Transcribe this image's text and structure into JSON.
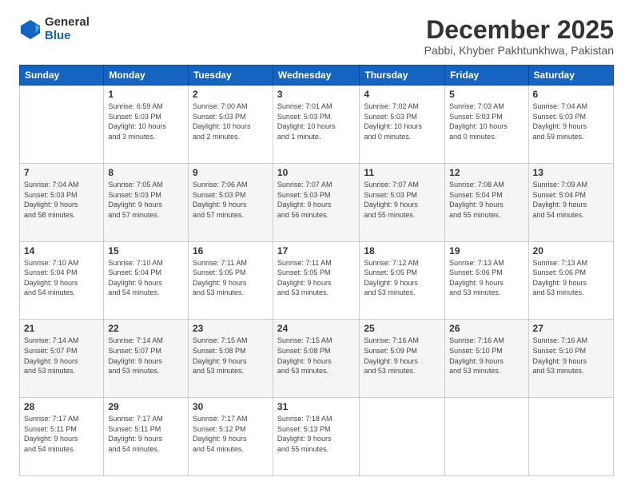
{
  "logo": {
    "general": "General",
    "blue": "Blue"
  },
  "title": "December 2025",
  "location": "Pabbi, Khyber Pakhtunkhwa, Pakistan",
  "weekdays": [
    "Sunday",
    "Monday",
    "Tuesday",
    "Wednesday",
    "Thursday",
    "Friday",
    "Saturday"
  ],
  "weeks": [
    [
      {
        "day": "",
        "info": ""
      },
      {
        "day": "1",
        "info": "Sunrise: 6:59 AM\nSunset: 5:03 PM\nDaylight: 10 hours\nand 3 minutes."
      },
      {
        "day": "2",
        "info": "Sunrise: 7:00 AM\nSunset: 5:03 PM\nDaylight: 10 hours\nand 2 minutes."
      },
      {
        "day": "3",
        "info": "Sunrise: 7:01 AM\nSunset: 5:03 PM\nDaylight: 10 hours\nand 1 minute."
      },
      {
        "day": "4",
        "info": "Sunrise: 7:02 AM\nSunset: 5:03 PM\nDaylight: 10 hours\nand 0 minutes."
      },
      {
        "day": "5",
        "info": "Sunrise: 7:03 AM\nSunset: 5:03 PM\nDaylight: 10 hours\nand 0 minutes."
      },
      {
        "day": "6",
        "info": "Sunrise: 7:04 AM\nSunset: 5:03 PM\nDaylight: 9 hours\nand 59 minutes."
      }
    ],
    [
      {
        "day": "7",
        "info": "Sunrise: 7:04 AM\nSunset: 5:03 PM\nDaylight: 9 hours\nand 58 minutes."
      },
      {
        "day": "8",
        "info": "Sunrise: 7:05 AM\nSunset: 5:03 PM\nDaylight: 9 hours\nand 57 minutes."
      },
      {
        "day": "9",
        "info": "Sunrise: 7:06 AM\nSunset: 5:03 PM\nDaylight: 9 hours\nand 57 minutes."
      },
      {
        "day": "10",
        "info": "Sunrise: 7:07 AM\nSunset: 5:03 PM\nDaylight: 9 hours\nand 56 minutes."
      },
      {
        "day": "11",
        "info": "Sunrise: 7:07 AM\nSunset: 5:03 PM\nDaylight: 9 hours\nand 55 minutes."
      },
      {
        "day": "12",
        "info": "Sunrise: 7:08 AM\nSunset: 5:04 PM\nDaylight: 9 hours\nand 55 minutes."
      },
      {
        "day": "13",
        "info": "Sunrise: 7:09 AM\nSunset: 5:04 PM\nDaylight: 9 hours\nand 54 minutes."
      }
    ],
    [
      {
        "day": "14",
        "info": "Sunrise: 7:10 AM\nSunset: 5:04 PM\nDaylight: 9 hours\nand 54 minutes."
      },
      {
        "day": "15",
        "info": "Sunrise: 7:10 AM\nSunset: 5:04 PM\nDaylight: 9 hours\nand 54 minutes."
      },
      {
        "day": "16",
        "info": "Sunrise: 7:11 AM\nSunset: 5:05 PM\nDaylight: 9 hours\nand 53 minutes."
      },
      {
        "day": "17",
        "info": "Sunrise: 7:11 AM\nSunset: 5:05 PM\nDaylight: 9 hours\nand 53 minutes."
      },
      {
        "day": "18",
        "info": "Sunrise: 7:12 AM\nSunset: 5:05 PM\nDaylight: 9 hours\nand 53 minutes."
      },
      {
        "day": "19",
        "info": "Sunrise: 7:13 AM\nSunset: 5:06 PM\nDaylight: 9 hours\nand 53 minutes."
      },
      {
        "day": "20",
        "info": "Sunrise: 7:13 AM\nSunset: 5:06 PM\nDaylight: 9 hours\nand 53 minutes."
      }
    ],
    [
      {
        "day": "21",
        "info": "Sunrise: 7:14 AM\nSunset: 5:07 PM\nDaylight: 9 hours\nand 53 minutes."
      },
      {
        "day": "22",
        "info": "Sunrise: 7:14 AM\nSunset: 5:07 PM\nDaylight: 9 hours\nand 53 minutes."
      },
      {
        "day": "23",
        "info": "Sunrise: 7:15 AM\nSunset: 5:08 PM\nDaylight: 9 hours\nand 53 minutes."
      },
      {
        "day": "24",
        "info": "Sunrise: 7:15 AM\nSunset: 5:08 PM\nDaylight: 9 hours\nand 53 minutes."
      },
      {
        "day": "25",
        "info": "Sunrise: 7:16 AM\nSunset: 5:09 PM\nDaylight: 9 hours\nand 53 minutes."
      },
      {
        "day": "26",
        "info": "Sunrise: 7:16 AM\nSunset: 5:10 PM\nDaylight: 9 hours\nand 53 minutes."
      },
      {
        "day": "27",
        "info": "Sunrise: 7:16 AM\nSunset: 5:10 PM\nDaylight: 9 hours\nand 53 minutes."
      }
    ],
    [
      {
        "day": "28",
        "info": "Sunrise: 7:17 AM\nSunset: 5:11 PM\nDaylight: 9 hours\nand 54 minutes."
      },
      {
        "day": "29",
        "info": "Sunrise: 7:17 AM\nSunset: 5:11 PM\nDaylight: 9 hours\nand 54 minutes."
      },
      {
        "day": "30",
        "info": "Sunrise: 7:17 AM\nSunset: 5:12 PM\nDaylight: 9 hours\nand 54 minutes."
      },
      {
        "day": "31",
        "info": "Sunrise: 7:18 AM\nSunset: 5:13 PM\nDaylight: 9 hours\nand 55 minutes."
      },
      {
        "day": "",
        "info": ""
      },
      {
        "day": "",
        "info": ""
      },
      {
        "day": "",
        "info": ""
      }
    ]
  ]
}
